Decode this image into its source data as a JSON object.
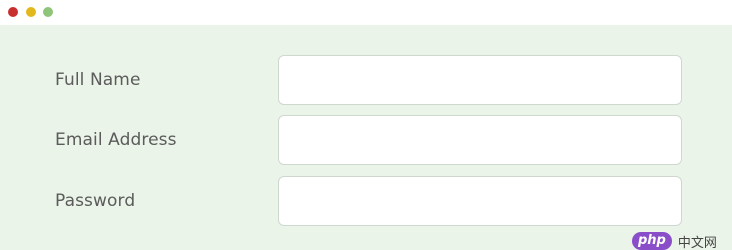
{
  "window": {
    "controls": {
      "close_color": "#c8302f",
      "minimize_color": "#e3b81f",
      "zoom_color": "#8fc57a"
    }
  },
  "form": {
    "fields": [
      {
        "label": "Full Name",
        "value": "",
        "placeholder": ""
      },
      {
        "label": "Email Address",
        "value": "",
        "placeholder": ""
      },
      {
        "label": "Password",
        "value": "",
        "placeholder": ""
      }
    ]
  },
  "watermark": {
    "badge": "php",
    "text": "中文网"
  },
  "colors": {
    "content_background": "#eaf4e8",
    "label_text": "#5b5b5b",
    "input_border": "#cfd8cf"
  }
}
